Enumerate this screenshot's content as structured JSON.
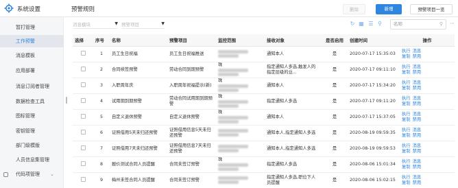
{
  "header": {
    "app_title": "系统设置",
    "page_title": "预警规则",
    "delete_label": "删除",
    "add_label": "新增",
    "overview_label": "预警项目一览"
  },
  "sidebar": {
    "items": [
      {
        "label": "暂打管理"
      },
      {
        "label": "工作预警"
      },
      {
        "label": "消息模板"
      },
      {
        "label": "应用部署"
      },
      {
        "label": "消息订阅者管理"
      },
      {
        "label": "数据检查工具"
      },
      {
        "label": "图标管理"
      },
      {
        "label": "密钥管理"
      },
      {
        "label": "部门级模版"
      },
      {
        "label": "人员信息集管理"
      },
      {
        "label": "代码项管理"
      }
    ]
  },
  "filters": {
    "module_placeholder": "消息模块",
    "project_placeholder": "预警项目",
    "search_placeholder": "名称"
  },
  "table": {
    "headers": {
      "select": "选择",
      "index": "序号",
      "name": "名称",
      "item": "预警项目",
      "scope": "监控范围",
      "receiver": "接收对象",
      "enabled": "是否启用",
      "created": "创建时间",
      "ops": "操作"
    },
    "op_labels": {
      "run": "执行",
      "msg": "消息",
      "copy": "复制",
      "disable": "禁用"
    },
    "rows": [
      {
        "index": "1",
        "name": "员工生日祝福",
        "item": "员工生日祝福推送",
        "scope": "",
        "receiver": "通知本人",
        "enabled": "是",
        "created": "2020-07-17 15:35:03"
      },
      {
        "index": "2",
        "name": "合同续签预警",
        "item": "劳动合同到期预警",
        "scope": "珠",
        "receiver": "指定通知人多选,触发人的指定层级的业...",
        "enabled": "是",
        "created": "2020-07-17 09:11:10"
      },
      {
        "index": "3",
        "name": "入职周年庆",
        "item": "入职周年祝福提示(新)",
        "scope": "珠",
        "receiver": "通知本人",
        "enabled": "是",
        "created": "2020-07-17 15:34:20"
      },
      {
        "index": "4",
        "name": "试用期到期预警",
        "item": "劳动合同试用期到期预警",
        "scope": "珠",
        "receiver": "指定通知人多选",
        "enabled": "是",
        "created": "2020-07-17 09:11:20"
      },
      {
        "index": "5",
        "name": "自定义退休预警",
        "item": "自定义退休预警",
        "scope": "珠",
        "receiver": "通知本人",
        "enabled": "是",
        "created": "2020-07-17 15:37:05"
      },
      {
        "index": "6",
        "name": "证照借用5天未归还预警",
        "item": "证照借用信息5天未归还预警",
        "scope": "",
        "receiver": "通知本人,指定通知人多选",
        "enabled": "是",
        "created": "2020-08-19 09:59:35"
      },
      {
        "index": "7",
        "name": "证照借用7天未归还预警",
        "item": "证照借用信息7天未归还预警",
        "scope": "",
        "receiver": "通知本人,指定通知人多选",
        "enabled": "是",
        "created": "2020-08-19 09:59:53"
      },
      {
        "index": "8",
        "name": "报价测试合同人员提醒",
        "item": "合同未签订预警",
        "scope": "珠",
        "receiver": "指定通知人多选",
        "enabled": "是",
        "created": "2020-08-06 15:01:34"
      },
      {
        "index": "9",
        "name": "梅州未签合同人员提醒",
        "item": "合同未签订预警",
        "scope": "",
        "receiver": "指定通知人多选,职位下人员提醒",
        "enabled": "是",
        "created": "2020-08-06 15:02:15"
      }
    ]
  }
}
